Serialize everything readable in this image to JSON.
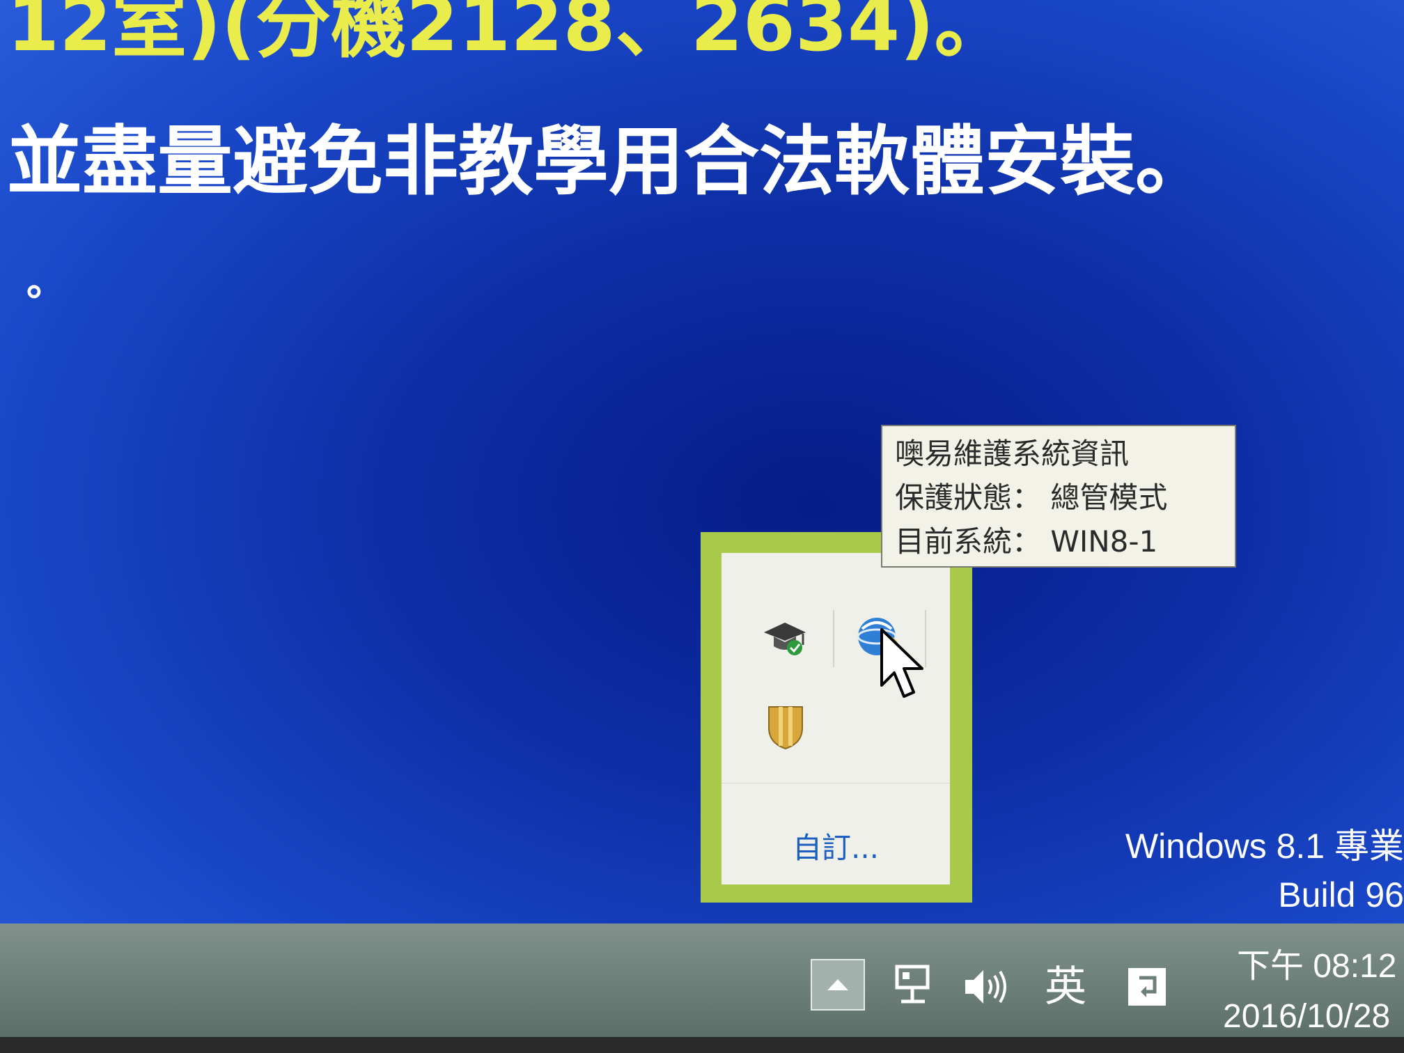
{
  "desktop": {
    "line1": "12室)(分機2128、2634)。",
    "line2": "並盡量避免非教學用合法軟體安裝。",
    "line3": "。",
    "watermark": {
      "edition": "Windows 8.1 專業",
      "build": "Build 96"
    }
  },
  "tray_popup": {
    "icons": [
      {
        "name": "mortarboard-check-icon"
      },
      {
        "name": "globe-shield-icon"
      },
      {
        "name": "yellow-shield-icon"
      }
    ],
    "customize_label": "自訂..."
  },
  "tooltip": {
    "title": "噢易維護系統資訊",
    "line1": "保護狀態： 總管模式",
    "line2": "目前系統： WIN8-1"
  },
  "taskbar": {
    "show_hidden_icon": "chevron-up-icon",
    "network_icon": "network-icon",
    "volume_icon": "speaker-icon",
    "ime": "英",
    "action_center_icon": "action-center-icon",
    "clock": {
      "time": "下午 08:12",
      "date": "2016/10/28"
    }
  },
  "colors": {
    "desktop_blue": "#0d2fa6",
    "highlight_yellow": "#e9ec4a",
    "tray_border_green": "#a9c94a",
    "link_blue": "#1d5fbe"
  }
}
